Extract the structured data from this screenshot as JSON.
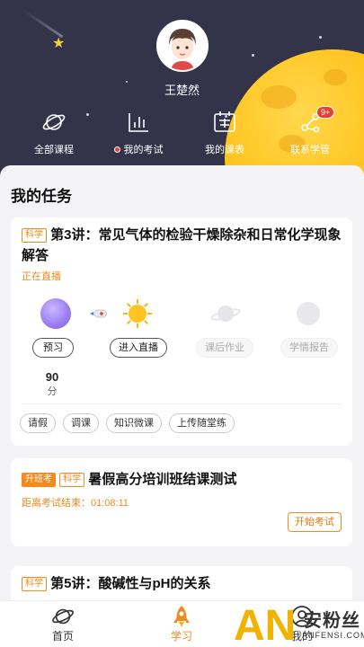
{
  "profile": {
    "name": "王楚然"
  },
  "nav": {
    "items": [
      {
        "label": "全部课程",
        "icon": "planet-icon"
      },
      {
        "label": "我的考试",
        "icon": "bar-chart-icon",
        "dot": true
      },
      {
        "label": "我的课表",
        "icon": "schedule-icon"
      },
      {
        "label": "联系学管",
        "icon": "contact-icon",
        "badge": "9+"
      }
    ]
  },
  "section": {
    "title": "我的任务"
  },
  "task1": {
    "tag": "科学",
    "title": "第3讲：常见气体的检验干燥除杂和日常化学现象解答",
    "status": "正在直播",
    "steps": [
      {
        "label": "预习",
        "state": "active"
      },
      {
        "label": "进入直播",
        "state": "active"
      },
      {
        "label": "课后作业",
        "state": "inactive"
      },
      {
        "label": "学情报告",
        "state": "inactive"
      }
    ],
    "score": {
      "value": "90",
      "unit": "分"
    },
    "actions": [
      "请假",
      "调课",
      "知识微课",
      "上传随堂练"
    ]
  },
  "task2": {
    "tag_primary": "升班考",
    "tag": "科学",
    "title": "暑假高分培训班结课测试",
    "countdown": "距离考试结束：01:08:11",
    "button": "开始考试"
  },
  "task3": {
    "tag": "科学",
    "title": "第5讲：酸碱性与pH的关系"
  },
  "tabbar": {
    "items": [
      {
        "label": "首页",
        "icon": "planet-icon"
      },
      {
        "label": "学习",
        "icon": "rocket-icon",
        "active": true
      },
      {
        "label": "我的",
        "icon": "user-icon"
      }
    ]
  },
  "watermark": {
    "text": "安粉丝",
    "sub": "ANFENSI.COM",
    "letters": "AN"
  },
  "colors": {
    "accent": "#f28a1e",
    "header_bg": "#33334a",
    "planet": "#ffc21a",
    "badge": "#e8402f"
  }
}
